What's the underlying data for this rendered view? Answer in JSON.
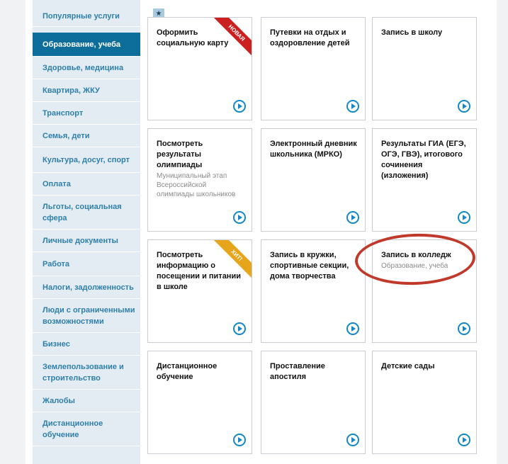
{
  "sidebar": {
    "items": [
      {
        "label": "Популярные услуги",
        "active": false
      },
      {
        "label": "Образование, учеба",
        "active": true
      },
      {
        "label": "Здоровье, медицина",
        "active": false
      },
      {
        "label": "Квартира, ЖКУ",
        "active": false
      },
      {
        "label": "Транспорт",
        "active": false
      },
      {
        "label": "Семья, дети",
        "active": false
      },
      {
        "label": "Культура, досуг, спорт",
        "active": false
      },
      {
        "label": "Оплата",
        "active": false
      },
      {
        "label": "Льготы, социальная сфера",
        "active": false
      },
      {
        "label": "Личные документы",
        "active": false
      },
      {
        "label": "Работа",
        "active": false
      },
      {
        "label": "Налоги, задолженность",
        "active": false
      },
      {
        "label": "Люди с ограниченными возможностями",
        "active": false
      },
      {
        "label": "Бизнес",
        "active": false
      },
      {
        "label": "Землепользование и строительство",
        "active": false
      },
      {
        "label": "Жалобы",
        "active": false
      },
      {
        "label": "Дистанционное обучение",
        "active": false
      }
    ],
    "bookmark_icon": "star-icon",
    "bookmark_glyph": "★"
  },
  "cards": [
    {
      "title": "Оформить социальную карту",
      "ribbon": "Новая",
      "ribbon_color": "#cc1f1f"
    },
    {
      "title": "Путевки на отдых и оздоровление детей"
    },
    {
      "title": "Запись в школу"
    },
    {
      "title": "Посмотреть результаты олимпиады",
      "subtitle": "Муниципальный этап Всероссийской олимпиады школьников"
    },
    {
      "title": "Электронный дневник школьника (МРКО)"
    },
    {
      "title": "Результаты ГИА (ЕГЭ, ОГЭ, ГВЭ), итогового сочинения (изложения)"
    },
    {
      "title": "Посмотреть информацию о посещении и питании в школе",
      "ribbon": "Хит!",
      "ribbon_color": "#e6a51a"
    },
    {
      "title": "Запись в кружки, спортивные секции, дома творчества"
    },
    {
      "title": "Запись в колледж",
      "subtitle": "Образование, учеба",
      "annotation_circle_color": "#c0392b"
    },
    {
      "title": "Дистанционное обучение"
    },
    {
      "title": "Проставление апостиля"
    },
    {
      "title": "Детские сады"
    }
  ],
  "colors": {
    "active_bg": "#0d6e9c",
    "link": "#2e7faa",
    "play_icon": "#1387c8"
  },
  "card_icon": "play-circle-icon"
}
